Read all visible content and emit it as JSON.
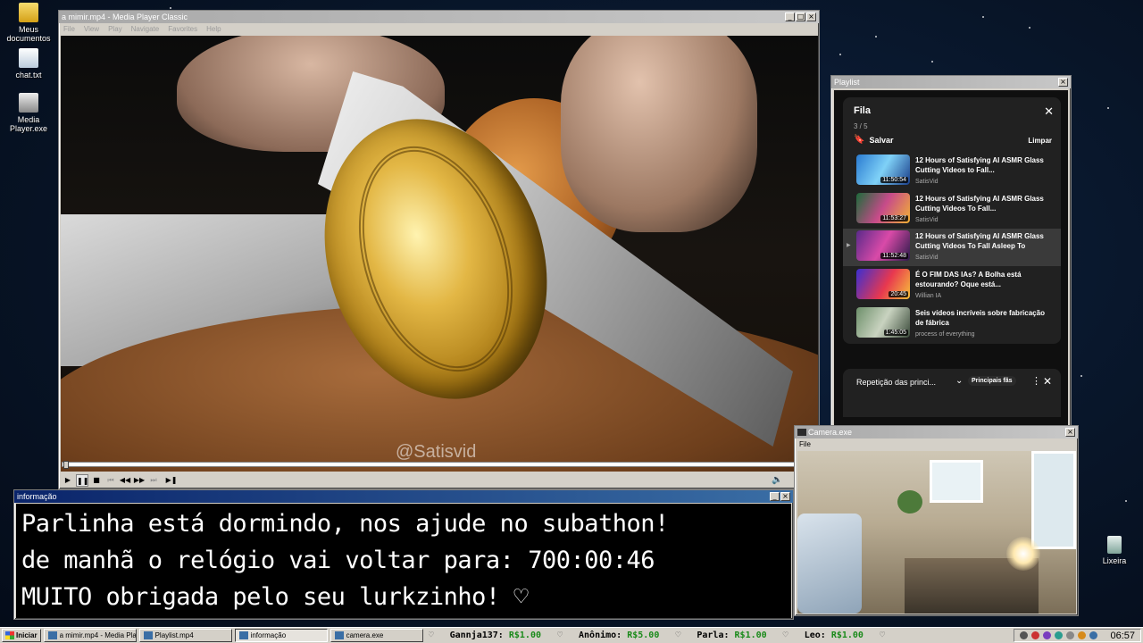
{
  "desktop": {
    "icons": [
      {
        "label": "Meus documentos",
        "icon": "folder-icon"
      },
      {
        "label": "chat.txt",
        "icon": "notepad-icon"
      },
      {
        "label": "Media Player.exe",
        "icon": "media-player-icon"
      },
      {
        "label": "Lixeira",
        "icon": "recycle-bin-icon"
      }
    ]
  },
  "media_player": {
    "title": "a mimir.mp4 - Media Player Classic",
    "menu": [
      "File",
      "View",
      "Play",
      "Navigate",
      "Favorites",
      "Help"
    ],
    "watermark": "@Satisvid",
    "progress": 0
  },
  "playlist_window": {
    "title": "Playlist",
    "queue_title": "Fila",
    "queue_count": "3 / 5",
    "save_label": "Salvar",
    "clear_label": "Limpar",
    "items": [
      {
        "title": "12 Hours of Satisfying AI ASMR Glass Cutting Videos to Fall...",
        "channel": "SatisVid",
        "duration": "11:50:54",
        "active": false
      },
      {
        "title": "12 Hours of Satisfying AI ASMR Glass Cutting Videos To Fall...",
        "channel": "SatisVid",
        "duration": "11:53:27",
        "active": false
      },
      {
        "title": "12 Hours of Satisfying AI ASMR Glass Cutting Videos To Fall Asleep To",
        "channel": "SatisVid",
        "duration": "11:52:48",
        "active": true
      },
      {
        "title": "É O FIM DAS IAs? A Bolha está estourando? Oque está...",
        "channel": "Willian IA",
        "duration": "20:45",
        "active": false
      },
      {
        "title": "Seis vídeos incríveis sobre fabricação de fábrica",
        "channel": "process of everything",
        "duration": "1:45:05",
        "active": false
      }
    ],
    "loop_label": "Repetição das princi...",
    "loop_badge": "Principais fãs"
  },
  "info_window": {
    "title": "informação",
    "lines": [
      "Parlinha está dormindo, nos ajude no subathon!",
      "de manhã o relógio vai voltar para:  700:00:46",
      "MUITO obrigada pelo seu lurkzinho! ♡"
    ]
  },
  "camera_window": {
    "title": "Camera.exe",
    "menu": [
      "File"
    ]
  },
  "taskbar": {
    "start_label": "Iniciar",
    "tasks": [
      {
        "label": "a mimir.mp4 - Media Playe...",
        "pressed": false
      },
      {
        "label": "Playlist.mp4",
        "pressed": false
      },
      {
        "label": "informação",
        "pressed": true
      },
      {
        "label": "camera.exe",
        "pressed": false
      }
    ],
    "ticker": [
      {
        "name": "Gannja137:",
        "amount": "R$1.00"
      },
      {
        "name": "Anônimo:",
        "amount": "R$5.00"
      },
      {
        "name": "Parla:",
        "amount": "R$1.00"
      },
      {
        "name": "Leo:",
        "amount": "R$1.00"
      }
    ],
    "clock": "06:57"
  }
}
